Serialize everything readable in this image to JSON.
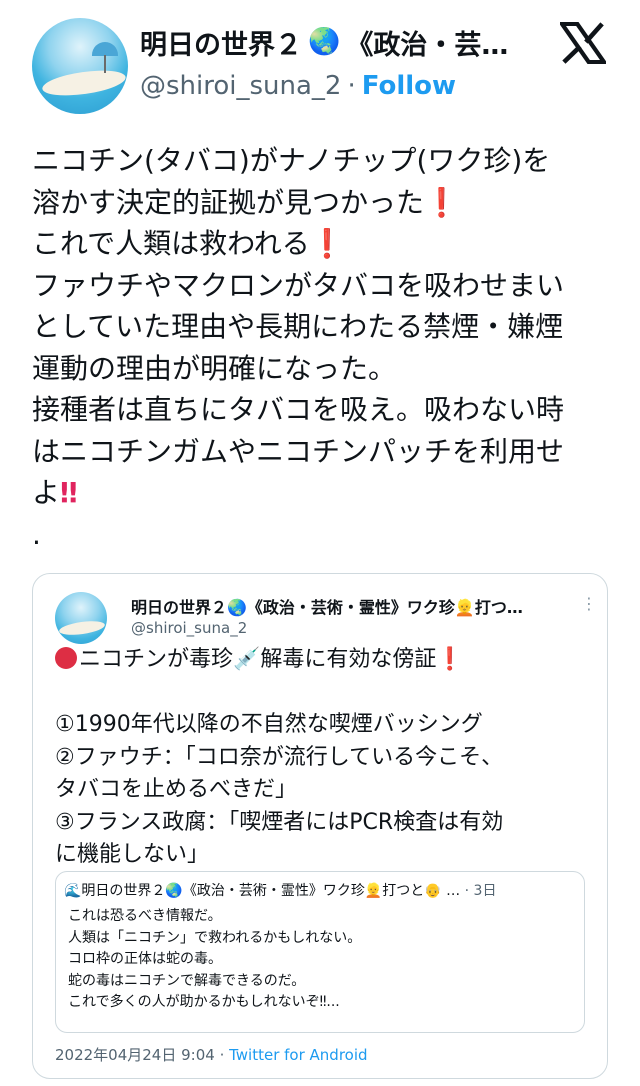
{
  "author": {
    "display_name": "明日の世界２",
    "name_rest": "《政治・芸…",
    "handle": "@shiroi_suna_2",
    "separator": "·",
    "follow_label": "Follow"
  },
  "tweet": {
    "lines": [
      "ニコチン(タバコ)がナノチップ(ワク珍)を",
      "溶かす決定的証拠が見つかった",
      "これで人類は救われる",
      "ファウチやマクロンがタバコを吸わせまい",
      "としていた理由や長期にわたる禁煙・嫌煙",
      "運動の理由が明確になった。",
      "接種者は直ちにタバコを吸え。吸わない時",
      "はニコチンガムやニコチンパッチを利用せ",
      "よ",
      "."
    ],
    "excl_single": "❗",
    "excl_double": "‼"
  },
  "quote": {
    "name": "明日の世界２🌏《政治・芸術・霊性》ワク珍👱打つ…",
    "handle": "@shiroi_suna_2",
    "menu": "⋮",
    "lines": [
      "ニコチンが毒珍💉解毒に有効な傍証❗",
      "",
      "①1990年代以降の不自然な喫煙バッシング",
      "②ファウチ：「コロ奈が流行している今こそ、",
      "タバコを止めるべきだ」",
      "③フランス政腐：「喫煙者にはPCR検査は有効",
      "に機能しない」"
    ],
    "inner": {
      "head_name": "🌊明日の世界２🌏《政治・芸術・霊性》ワク珍👱打つと👴 …",
      "head_date": "· 3日",
      "lines": [
        "これは恐るべき情報だ。",
        "人類は「ニコチン」で救われるかもしれない。",
        "コロ枠の正体は蛇の毒。",
        "蛇の毒はニコチンで解毒できるのだ。",
        "これで多くの人が助かるかもしれないぞ‼..."
      ]
    },
    "timestamp": "2022年04月24日 9:04 · ",
    "source": "Twitter for Android"
  },
  "colors": {
    "accent": "#1d9bf0",
    "text": "#0f1419",
    "muted": "#536471",
    "border": "#cfd9de",
    "red": "#dd2e44"
  }
}
